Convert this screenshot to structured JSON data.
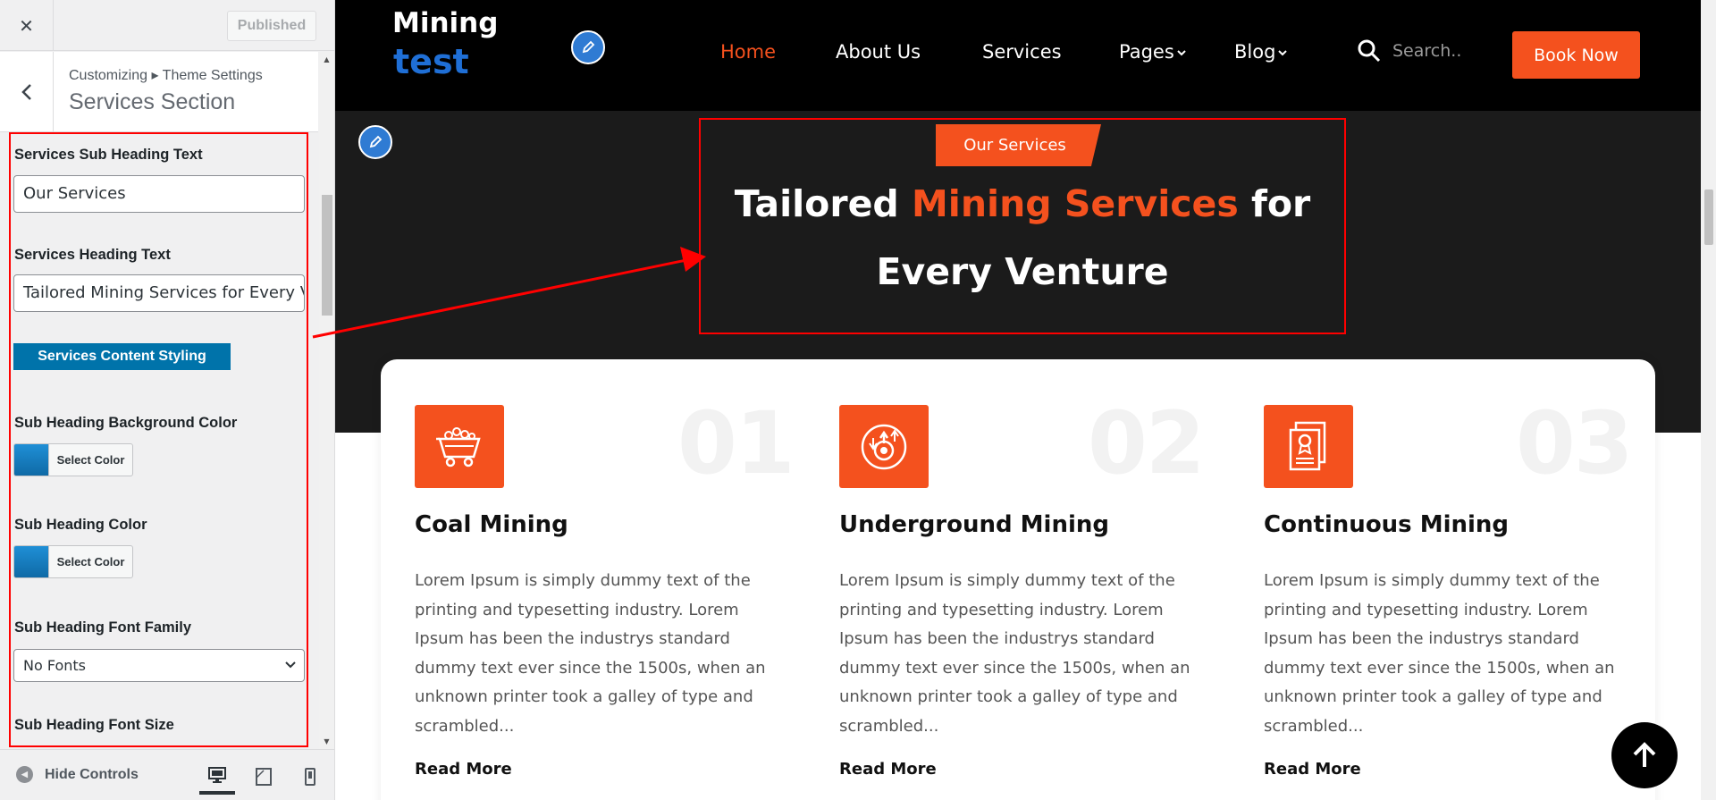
{
  "customizer": {
    "close_glyph": "✕",
    "published_label": "Published",
    "breadcrumb": "Customizing ▸ Theme Settings",
    "section_title": "Services Section",
    "controls": {
      "sub_heading_text_label": "Services Sub Heading Text",
      "sub_heading_text_value": "Our Services",
      "heading_text_label": "Services Heading Text",
      "heading_text_value": "Tailored Mining Services for Every Venture",
      "content_styling_button": "Services Content Styling",
      "sub_heading_bg_color_label": "Sub Heading Background Color",
      "select_color_label": "Select Color",
      "sub_heading_color_label": "Sub Heading Color",
      "sub_heading_font_family_label": "Sub Heading Font Family",
      "sub_heading_font_family_value": "No Fonts",
      "sub_heading_font_size_label": "Sub Heading Font Size"
    },
    "footer": {
      "hide_controls_label": "Hide Controls",
      "devices": [
        "desktop",
        "tablet",
        "mobile"
      ],
      "active_device": "desktop"
    }
  },
  "site": {
    "logo_line1": "Mining",
    "logo_line2": "test",
    "nav": [
      {
        "label": "Home",
        "active": true,
        "dropdown": false
      },
      {
        "label": "About Us",
        "active": false,
        "dropdown": false
      },
      {
        "label": "Services",
        "active": false,
        "dropdown": false
      },
      {
        "label": "Pages",
        "active": false,
        "dropdown": true
      },
      {
        "label": "Blog",
        "active": false,
        "dropdown": true
      }
    ],
    "search_placeholder": "Search..",
    "book_button": "Book Now"
  },
  "services": {
    "sub_heading": "Our Services",
    "heading_before": "Tailored ",
    "heading_highlight": "Mining Services",
    "heading_after": " for Every Venture",
    "read_more_label": "Read More",
    "cards": [
      {
        "number": "01",
        "title": "Coal Mining",
        "icon": "mining-cart-icon",
        "text": "Lorem Ipsum is simply dummy text of the printing and typesetting industry. Lorem Ipsum has been the industrys standard dummy text ever since the 1500s, when an unknown printer took a galley of type and scrambled..."
      },
      {
        "number": "02",
        "title": "Underground Mining",
        "icon": "gear-cycle-icon",
        "text": "Lorem Ipsum is simply dummy text of the printing and typesetting industry. Lorem Ipsum has been the industrys standard dummy text ever since the 1500s, when an unknown printer took a galley of type and scrambled..."
      },
      {
        "number": "03",
        "title": "Continuous Mining",
        "icon": "certificate-document-icon",
        "text": "Lorem Ipsum is simply dummy text of the printing and typesetting industry. Lorem Ipsum has been the industrys standard dummy text ever since the 1500s, when an unknown printer took a galley of type and scrambled..."
      }
    ]
  },
  "colors": {
    "accent": "#f4511e",
    "logo_blue": "#1f6fd6",
    "edit_blue": "#2f7bd3",
    "wp_button": "#0073aa",
    "annotation_red": "#ff0000",
    "dark_band": "#1b1b1b"
  }
}
